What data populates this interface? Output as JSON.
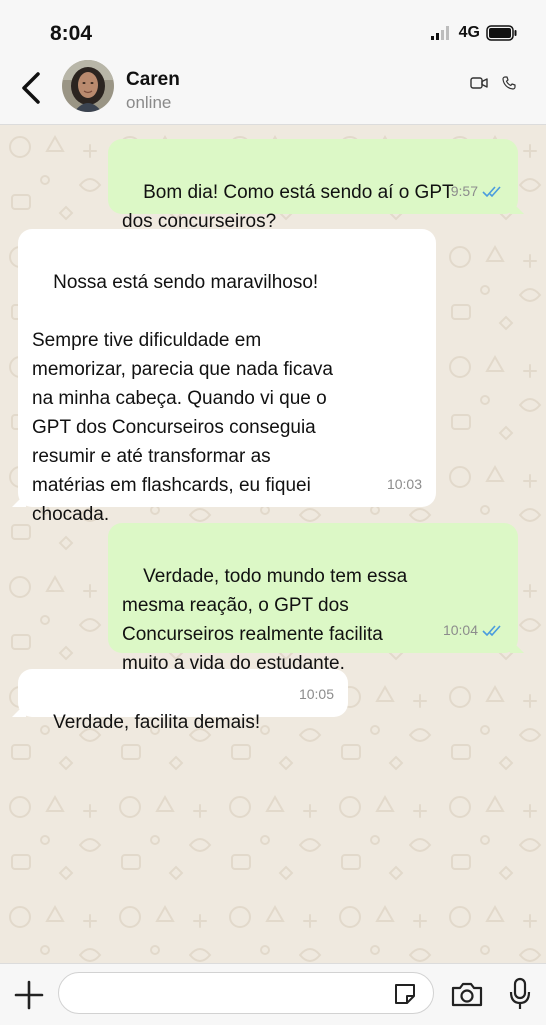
{
  "status_bar": {
    "time": "8:04",
    "network": "4G"
  },
  "header": {
    "contact_name": "Caren",
    "contact_status": "online"
  },
  "messages": [
    {
      "direction": "out",
      "text": "Bom dia! Como está sendo aí o GPT\ndos concurseiros?",
      "time": "9:57",
      "read": true
    },
    {
      "direction": "in",
      "text": "Nossa está sendo maravilhoso!\n\nSempre tive dificuldade em\nmemorizar, parecia que nada ficava\nna minha cabeça. Quando vi que o\nGPT dos Concurseiros conseguia\nresumir e até transformar as\nmatérias em flashcards, eu fiquei\nchocada.",
      "time": "10:03"
    },
    {
      "direction": "out",
      "text": "Verdade, todo mundo tem essa\nmesma reação, o GPT dos\nConcurseiros realmente facilita\nmuito a vida do estudante.",
      "time": "10:04",
      "read": true
    },
    {
      "direction": "in",
      "text": "Verdade, facilita demais!",
      "time": "10:05"
    }
  ],
  "composer": {
    "value": "",
    "placeholder": ""
  },
  "colors": {
    "outgoing_bubble": "#dcf8c6",
    "incoming_bubble": "#ffffff",
    "read_ticks": "#4a9cde",
    "chat_background": "#efe9df"
  }
}
